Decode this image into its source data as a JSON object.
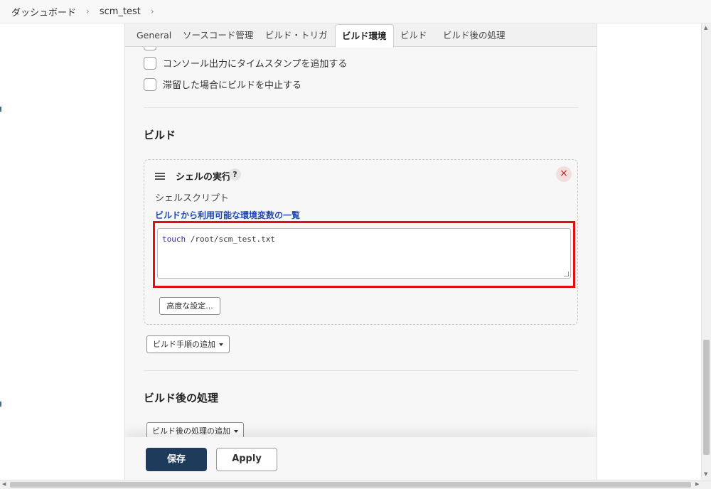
{
  "breadcrumb": {
    "items": [
      "ダッシュボード",
      "scm_test"
    ],
    "separator": "›"
  },
  "tabs": [
    "General",
    "ソースコード管理",
    "ビルド・トリガ",
    "ビルド環境",
    "ビルド",
    "ビルド後の処理"
  ],
  "active_tab": "ビルド環境",
  "build_env": {
    "options": [
      {
        "label": "コンソール出力にタイムスタンプを追加する",
        "checked": false
      },
      {
        "label": "滞留した場合にビルドを中止する",
        "checked": false
      }
    ]
  },
  "build": {
    "title": "ビルド",
    "step": {
      "title": "シェルの実行",
      "help": "?",
      "close": "×",
      "field_label": "シェルスクリプト",
      "env_link": "ビルドから利用可能な環境変数の一覧",
      "script_keyword": "touch",
      "script_rest": " /root/scm_test.txt",
      "advanced_label": "高度な設定..."
    },
    "add_step_label": "ビルド手順の追加"
  },
  "post_build": {
    "title": "ビルド後の処理",
    "add_label": "ビルド後の処理の追加"
  },
  "actions": {
    "save_label": "保存",
    "apply_label": "Apply"
  },
  "colors": {
    "save_bg": "#1f3b5c",
    "highlight": "#e01010",
    "link": "#2249b3",
    "close": "#c02020"
  }
}
